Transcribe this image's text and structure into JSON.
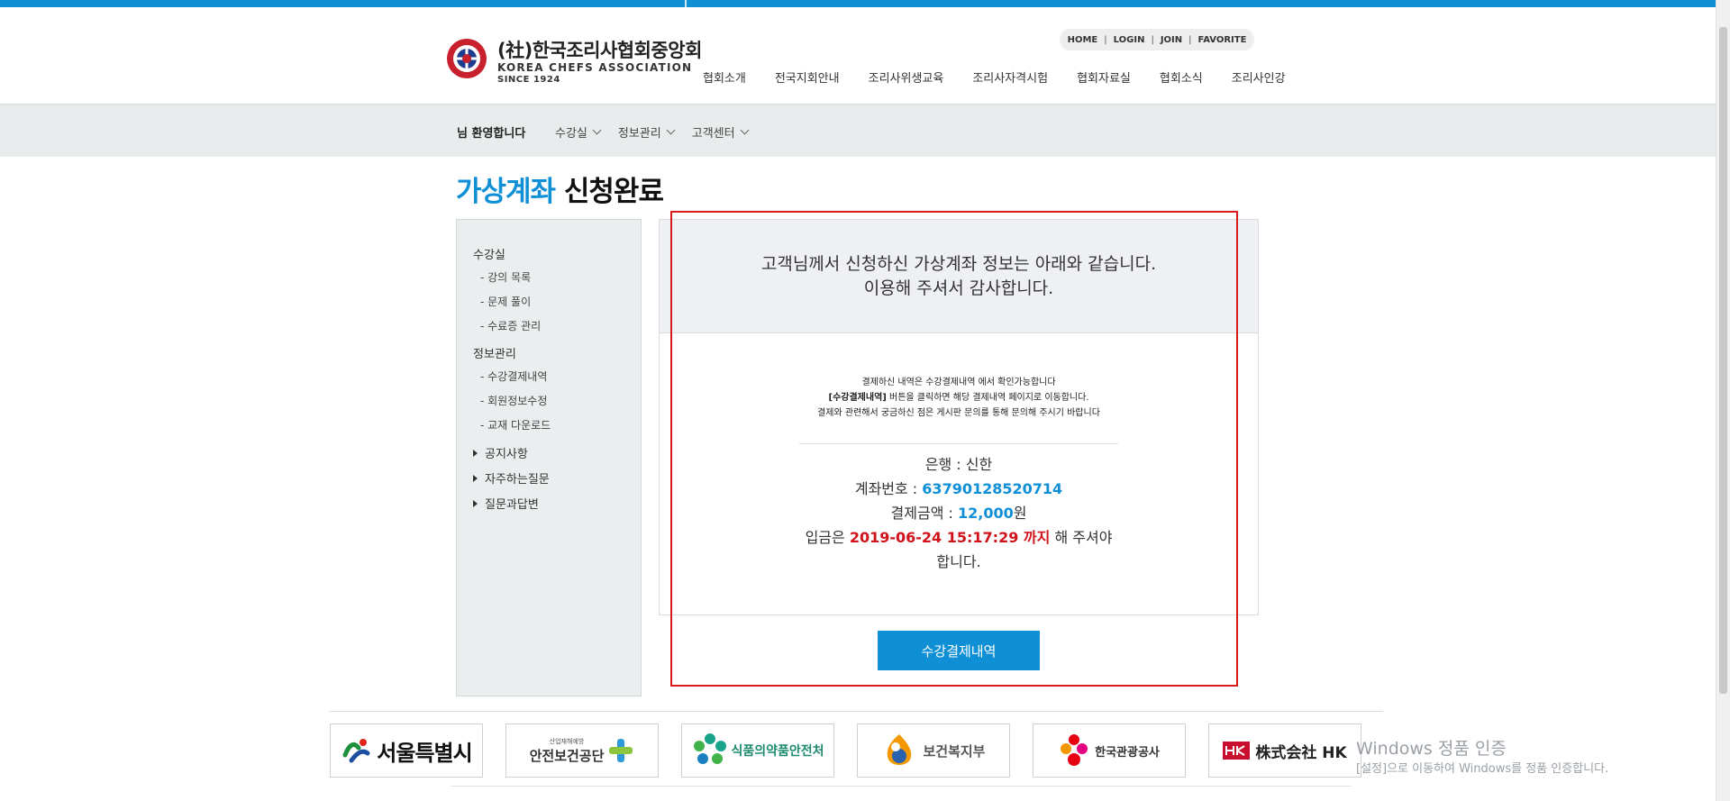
{
  "colors": {
    "brand": "#0f8fd6",
    "accent_red": "#d0121b",
    "highlight_box": "#d81b1b",
    "sidebar_bg": "#eaeeef"
  },
  "logo": {
    "korean_name": "(社)한국조리사협회중앙회",
    "english_name": "KOREA CHEFS ASSOCIATION",
    "since": "SINCE 1924",
    "icon": "association-emblem-icon"
  },
  "util_links": [
    "HOME",
    "LOGIN",
    "JOIN",
    "FAVORITE"
  ],
  "gnb": [
    "협회소개",
    "전국지회안내",
    "조리사위생교육",
    "조리사자격시험",
    "협회자료실",
    "협회소식",
    "조리사인강"
  ],
  "subbar": {
    "welcome": "님 환영합니다",
    "menus": [
      "수강실",
      "정보관리",
      "고객센터"
    ]
  },
  "page_title": {
    "highlight": "가상계좌",
    "rest": " 신청완료"
  },
  "sidebar": {
    "group1": {
      "title": "수강실",
      "items": [
        "- 강의 목록",
        "- 문제 풀이",
        "- 수료증 관리"
      ]
    },
    "group2": {
      "title": "정보관리",
      "items": [
        "- 수강결제내역",
        "- 회원정보수정",
        "- 교재 다운로드"
      ]
    },
    "links": [
      "공지사항",
      "자주하는질문",
      "질문과답변"
    ]
  },
  "message": {
    "line1": "고객님께서 신청하신 가상계좌 정보는 아래와 같습니다.",
    "line2": "이용해 주셔서 감사합니다."
  },
  "notice": {
    "line1": "결제하신 내역은 수강결제내역 에서 확인가능합니다",
    "line2_strong": "[수강결제내역]",
    "line2_rest": " 버튼을 클릭하면 해당 결제내역 페이지로 이동합니다.",
    "line3": "결제와 관련해서 궁금하신 점은 게시판 문의를 통해 문의해 주시기 바랍니다"
  },
  "account": {
    "bank_label": "은행 : ",
    "bank": "신한",
    "number_label": "계좌번호 : ",
    "number": "63790128520714",
    "amount_label": "결제금액 : ",
    "amount": "12,000",
    "amount_unit": "원",
    "deadline_prefix": "입금은 ",
    "deadline": "2019-06-24 15:17:29 까지",
    "deadline_suffix": " 해 주셔야 합니다."
  },
  "button": {
    "label": "수강결제내역"
  },
  "partners": [
    "서울특별시",
    "안전보건공단",
    "식품의약품안전처",
    "보건복지부",
    "한국관광공사",
    "株式会社 HK"
  ],
  "partner_captions": {
    "safety_small": "산업재해예방"
  },
  "watermark": {
    "title": "Windows 정품 인증",
    "sub": "[설정]으로 이동하여 Windows를 정품 인증합니다."
  }
}
